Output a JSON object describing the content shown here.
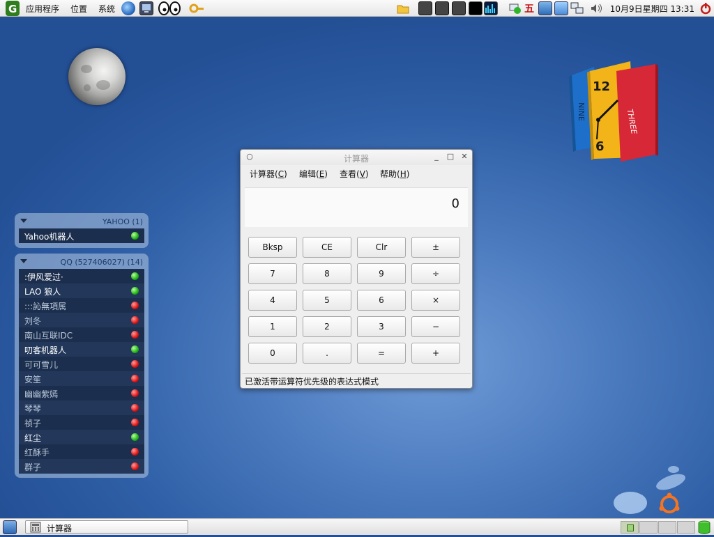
{
  "top_panel": {
    "menus": [
      "应用程序",
      "位置",
      "系统"
    ],
    "input_method": "五",
    "clock": "10月9日星期四 13:31"
  },
  "yahoo_panel": {
    "title": "YAHOO (1)",
    "contacts": [
      {
        "name": "Yahoo机器人",
        "status": "online"
      }
    ]
  },
  "qq_panel": {
    "title": "QQ (527406027) (14)",
    "contacts": [
      {
        "name": ":伊风爱过·",
        "status": "online"
      },
      {
        "name": "LAO 狼人",
        "status": "online"
      },
      {
        "name": ":::訫無項属",
        "status": "offline"
      },
      {
        "name": "刘冬",
        "status": "offline"
      },
      {
        "name": "南山互联IDC",
        "status": "offline"
      },
      {
        "name": "叨客机器人",
        "status": "online"
      },
      {
        "name": "可可雪儿",
        "status": "offline"
      },
      {
        "name": "安笙",
        "status": "offline"
      },
      {
        "name": "幽幽紫嫣",
        "status": "offline"
      },
      {
        "name": "琴琴",
        "status": "offline"
      },
      {
        "name": "祯子",
        "status": "offline"
      },
      {
        "name": "红尘",
        "status": "online"
      },
      {
        "name": "红酥手",
        "status": "offline"
      },
      {
        "name": "群子",
        "status": "offline"
      }
    ]
  },
  "calculator": {
    "title": "计算器",
    "menu": [
      {
        "label": "计算器(",
        "key": "C",
        "end": ")"
      },
      {
        "label": "编辑(",
        "key": "E",
        "end": ")"
      },
      {
        "label": "查看(",
        "key": "V",
        "end": ")"
      },
      {
        "label": "帮助(",
        "key": "H",
        "end": ")"
      }
    ],
    "display": "0",
    "buttons": [
      [
        "Bksp",
        "CE",
        "Clr",
        "±"
      ],
      [
        "7",
        "8",
        "9",
        "÷"
      ],
      [
        "4",
        "5",
        "6",
        "×"
      ],
      [
        "1",
        "2",
        "3",
        "−"
      ],
      [
        "0",
        ".",
        "=",
        "+"
      ]
    ],
    "status": "已激活带运算符优先级的表达式模式"
  },
  "desktop_clock": {
    "twelve": "12",
    "six": "6",
    "left_spine": "NINE",
    "right_spine": "THREE"
  },
  "taskbar": {
    "task_label": "计算器"
  },
  "colors": {
    "online": "#21b515",
    "offline": "#e11515",
    "desktop": "#3a6cb3"
  }
}
